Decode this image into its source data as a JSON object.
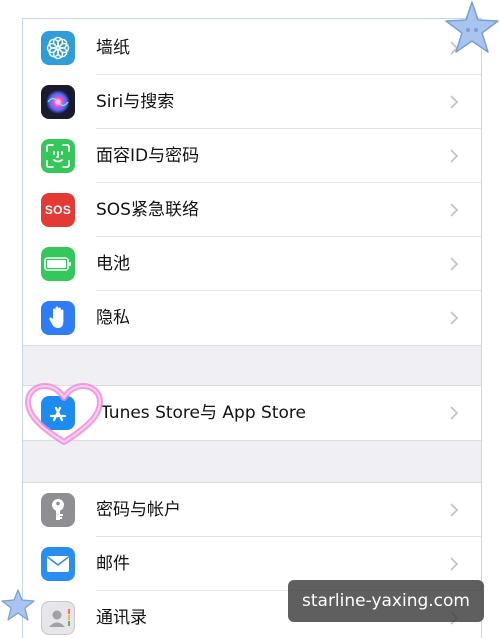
{
  "settings": {
    "items": [
      {
        "label": "墙纸",
        "icon": "wallpaper-flower-icon",
        "color": "#2f9ed8"
      },
      {
        "label": "Siri与搜索",
        "icon": "siri-icon",
        "color": "#1a1a2e"
      },
      {
        "label": "面容ID与密码",
        "icon": "face-id-icon",
        "color": "#34c759"
      },
      {
        "label": "SOS紧急联络",
        "icon": "sos-icon",
        "color": "#e53935",
        "icon_text": "SOS"
      },
      {
        "label": "电池",
        "icon": "battery-icon",
        "color": "#34c759"
      },
      {
        "label": "隐私",
        "icon": "privacy-hand-icon",
        "color": "#2f7df6"
      },
      {
        "label": "Tunes Store与 App Store",
        "icon": "app-store-icon",
        "color": "#1e8bf0"
      },
      {
        "label": "密码与帐户",
        "icon": "key-icon",
        "color": "#8e8e93"
      },
      {
        "label": "邮件",
        "icon": "mail-icon",
        "color": "#2a8df0"
      },
      {
        "label": "通讯录",
        "icon": "contacts-icon",
        "color": "#c7c7cc"
      }
    ]
  },
  "watermark": {
    "text": "starline-yaxing.com"
  },
  "colors": {
    "accent": "#2f7df6",
    "group_bg": "#efeff4",
    "heart": "#f28ad8",
    "star": "#8fb3e6"
  }
}
